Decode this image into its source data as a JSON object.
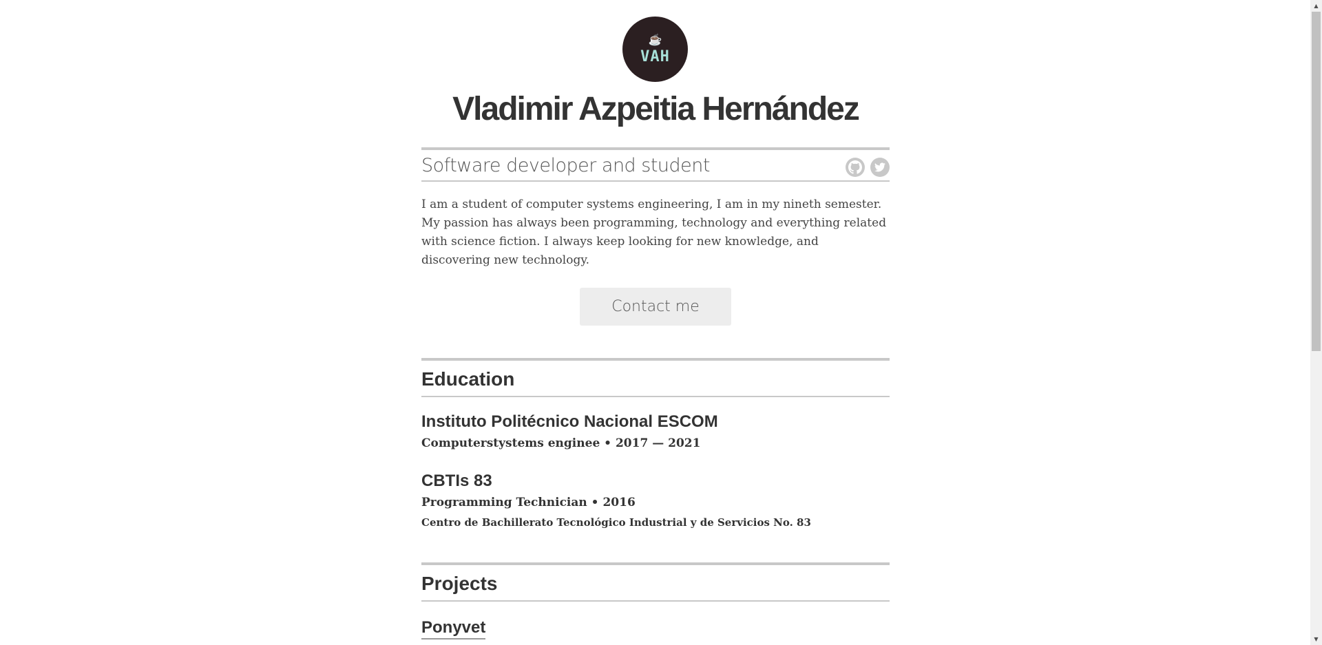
{
  "profile": {
    "avatar_initials": "VAH",
    "avatar_icon": "coffee-cup-icon",
    "name": "Vladimir Azpeitia Hernández",
    "tagline": "Software developer and student",
    "bio": "I am a student of computer systems engineering, I am in my nineth semester. My passion has always been programming, technology and everything related with science fiction. I always keep looking for new knowledge, and discovering new technology.",
    "contact_label": "Contact me"
  },
  "social": [
    {
      "icon": "github-icon"
    },
    {
      "icon": "twitter-icon"
    }
  ],
  "education": {
    "title": "Education",
    "items": [
      {
        "title": "Instituto Politécnico Nacional ESCOM",
        "meta": "Computerstystems enginee • 2017 — 2021"
      },
      {
        "title": "CBTIs 83",
        "meta": "Programming Technician • 2016",
        "description": "Centro de Bachillerato Tecnológico Industrial y de Servicios No. 83"
      }
    ]
  },
  "projects": {
    "title": "Projects",
    "items": [
      {
        "title": "Ponyvet"
      }
    ]
  },
  "colors": {
    "text": "#333333",
    "rule": "#c8c8c8",
    "avatar_bg": "#2b1f21",
    "avatar_text": "#a8e0d8",
    "button_bg": "#ededed"
  }
}
